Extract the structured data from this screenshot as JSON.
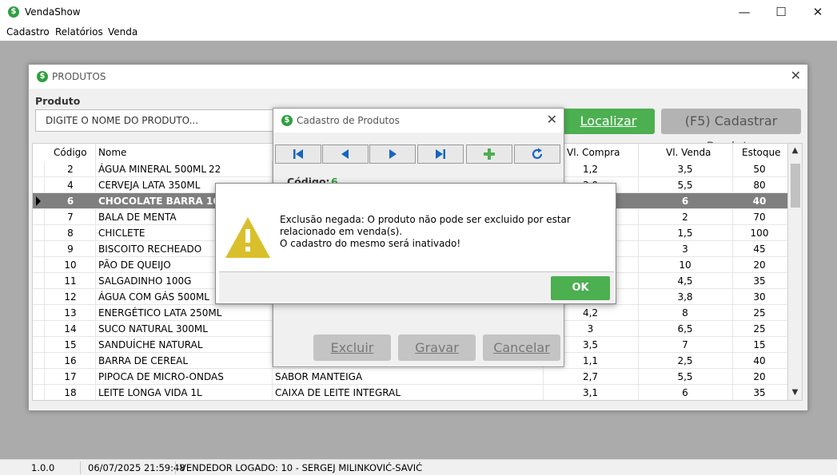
{
  "app": {
    "title": "VendaShow",
    "icon": "$"
  },
  "window_controls": {
    "minimize": "—",
    "maximize": "☐",
    "close": "✕"
  },
  "menu": [
    "Cadastro",
    "Relatórios",
    "Venda"
  ],
  "produtos_window": {
    "title": "PRODUTOS",
    "close": "✕",
    "produto_label": "Produto",
    "search_placeholder": "DIGITE O NOME DO PRODUTO...",
    "btn_localizar": "Localizar",
    "btn_cadastrar": "(F5) Cadastrar Produto",
    "columns": [
      "Código",
      "Nome",
      "Vl. Compra",
      "Vl. Venda",
      "Estoque"
    ],
    "rows": [
      {
        "codigo": "2",
        "nome": "ÁGUA MINERAL 500ML",
        "extra": "22",
        "descricao": "",
        "compra": "1,2",
        "venda": "3,5",
        "estoque": "50"
      },
      {
        "codigo": "4",
        "nome": "CERVEJA LATA 350ML",
        "extra": "",
        "descricao": "",
        "compra": "3,0",
        "venda": "5,5",
        "estoque": "80"
      },
      {
        "codigo": "6",
        "nome": "CHOCOLATE BARRA 100G",
        "extra": "",
        "descricao": "",
        "compra": "",
        "venda": "6",
        "estoque": "40",
        "selected": true
      },
      {
        "codigo": "7",
        "nome": "BALA DE MENTA",
        "extra": "",
        "descricao": "",
        "compra": "",
        "venda": "2",
        "estoque": "70"
      },
      {
        "codigo": "8",
        "nome": "CHICLETE",
        "extra": "",
        "descricao": "",
        "compra": "",
        "venda": "1,5",
        "estoque": "100"
      },
      {
        "codigo": "9",
        "nome": "BISCOITO RECHEADO",
        "extra": "",
        "descricao": "",
        "compra": "",
        "venda": "3",
        "estoque": "45"
      },
      {
        "codigo": "10",
        "nome": "PÃO DE QUEIJO",
        "extra": "",
        "descricao": "",
        "compra": "",
        "venda": "10",
        "estoque": "20"
      },
      {
        "codigo": "11",
        "nome": "SALGADINHO 100G",
        "extra": "",
        "descricao": "",
        "compra": "",
        "venda": "4,5",
        "estoque": "35"
      },
      {
        "codigo": "12",
        "nome": "ÁGUA COM GÁS 500ML",
        "extra": "",
        "descricao": "",
        "compra": "",
        "venda": "3,8",
        "estoque": "30"
      },
      {
        "codigo": "13",
        "nome": "ENERGÉTICO LATA 250ML",
        "extra": "",
        "descricao": "",
        "compra": "4,2",
        "venda": "8",
        "estoque": "25"
      },
      {
        "codigo": "14",
        "nome": "SUCO NATURAL 300ML",
        "extra": "",
        "descricao": "",
        "compra": "3",
        "venda": "6,5",
        "estoque": "25"
      },
      {
        "codigo": "15",
        "nome": "SANDUÍCHE NATURAL",
        "extra": "",
        "descricao": "",
        "compra": "3,5",
        "venda": "7",
        "estoque": "15"
      },
      {
        "codigo": "16",
        "nome": "BARRA DE CEREAL",
        "extra": "",
        "descricao": "",
        "compra": "1,1",
        "venda": "2,5",
        "estoque": "40"
      },
      {
        "codigo": "17",
        "nome": "PIPOCA DE MICRO-ONDAS",
        "extra": "",
        "descricao": "SABOR MANTEIGA",
        "compra": "2,7",
        "venda": "5,5",
        "estoque": "20"
      },
      {
        "codigo": "18",
        "nome": "LEITE LONGA VIDA 1L",
        "extra": "",
        "descricao": "CAIXA DE LEITE INTEGRAL",
        "compra": "3,1",
        "venda": "6",
        "estoque": "35"
      }
    ]
  },
  "cadastro_dialog": {
    "title": "Cadastro de Produtos",
    "close": "✕",
    "codigo_label": "Código:",
    "codigo_value": "6",
    "btn_excluir": "Excluir",
    "btn_gravar": "Gravar",
    "btn_cancelar": "Cancelar"
  },
  "message_box": {
    "line1": "Exclusão negada: O produto não pode ser excluido por estar relacionado em venda(s).",
    "line2": "O cadastro do mesmo será inativado!",
    "btn_ok": "OK",
    "icon": "warning-icon"
  },
  "status": {
    "version": "1.0.0",
    "datetime": "06/07/2025 21:59:48",
    "vendedor": "VENDEDOR LOGADO:  10 - SERGEJ MILINKOVIĆ-SAVIĆ"
  },
  "colors": {
    "accent_green": "#4caf50",
    "icon_green": "#2e9f3e",
    "selected_row": "#7f7f7f",
    "disabled_button": "#c4c4c4",
    "warning_yellow": "#d9bf2b"
  }
}
